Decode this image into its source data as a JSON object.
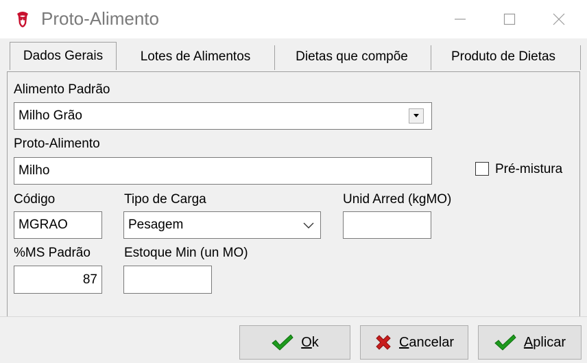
{
  "window": {
    "title": "Proto-Alimento"
  },
  "tabs": [
    {
      "label": "Dados Gerais",
      "active": true
    },
    {
      "label": "Lotes de Alimentos",
      "active": false
    },
    {
      "label": "Dietas que compõe",
      "active": false
    },
    {
      "label": "Produto de Dietas",
      "active": false
    }
  ],
  "form": {
    "alimento_padrao": {
      "label": "Alimento Padrão",
      "value": "Milho Grão"
    },
    "proto_alimento": {
      "label": "Proto-Alimento",
      "value": "Milho"
    },
    "pre_mistura": {
      "label": "Pré-mistura",
      "checked": false
    },
    "codigo": {
      "label": "Código",
      "value": "MGRAO"
    },
    "tipo_carga": {
      "label": "Tipo de Carga",
      "value": "Pesagem"
    },
    "unid_arred": {
      "label": "Unid Arred (kgMO)",
      "value": ""
    },
    "ms_padrao": {
      "label": "%MS Padrão",
      "value": "87"
    },
    "estoque_min": {
      "label": "Estoque Min (un MO)",
      "value": ""
    }
  },
  "buttons": {
    "ok": {
      "mnemonic": "O",
      "rest": "k"
    },
    "cancelar": {
      "mnemonic": "C",
      "rest": "ancelar"
    },
    "aplicar": {
      "mnemonic": "A",
      "rest": "plicar"
    }
  },
  "colors": {
    "check_green": "#1e9b1e",
    "cancel_red": "#c81e1e",
    "title_gray": "#7a7a7a"
  }
}
